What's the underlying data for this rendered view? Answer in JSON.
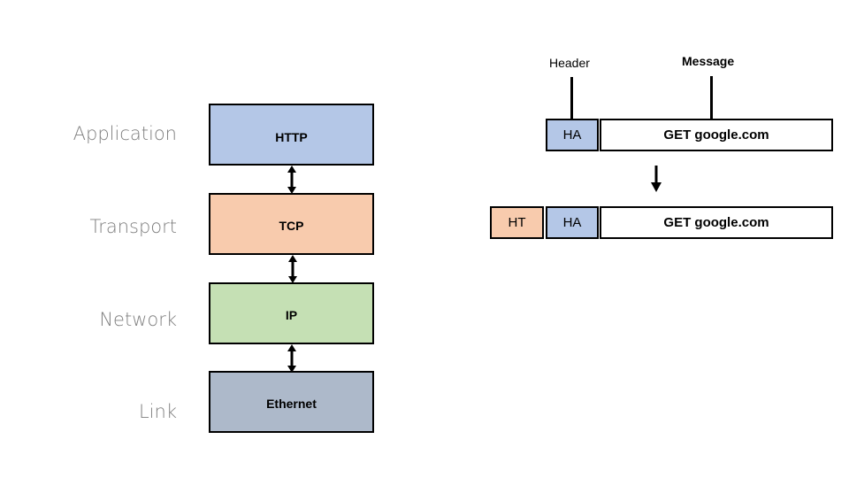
{
  "layers": [
    {
      "name": "Application",
      "protocol": "HTTP",
      "color": "#b4c7e7"
    },
    {
      "name": "Transport",
      "protocol": "TCP",
      "color": "#f8cbad"
    },
    {
      "name": "Network",
      "protocol": "IP",
      "color": "#c5e0b4"
    },
    {
      "name": "Link",
      "protocol": "Ethernet",
      "color": "#adb9ca"
    }
  ],
  "encapsulation": {
    "callouts": {
      "header": "Header",
      "message": "Message"
    },
    "before": {
      "app_header": "HA",
      "message": "GET google.com"
    },
    "after": {
      "transport_header": "HT",
      "app_header": "HA",
      "message": "GET google.com"
    }
  }
}
